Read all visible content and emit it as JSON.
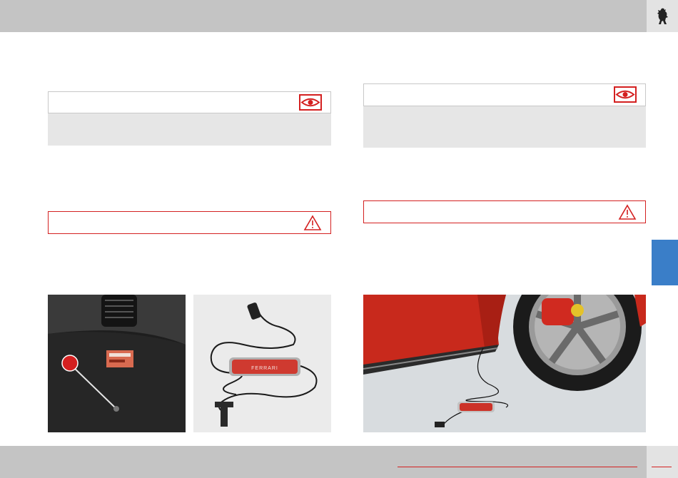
{
  "header": {
    "logo_icon": "prancing-horse-icon"
  },
  "left_column": {
    "note": {
      "icon": "eye-icon"
    },
    "warning": {
      "icon": "warning-triangle-icon"
    },
    "photos": [
      {
        "name": "dashboard-connector-photo",
        "callout_icon": "red-callout-dot-icon"
      },
      {
        "name": "battery-charger-photo"
      }
    ]
  },
  "right_column": {
    "note": {
      "icon": "eye-icon"
    },
    "warning": {
      "icon": "warning-triangle-icon"
    },
    "photos": [
      {
        "name": "car-charger-connected-photo"
      }
    ]
  },
  "side_tab": {
    "color": "#3a7ec8"
  },
  "colors": {
    "accent": "#d42020",
    "header_grey": "#c4c4c4",
    "note_grey": "#e6e6e6"
  }
}
